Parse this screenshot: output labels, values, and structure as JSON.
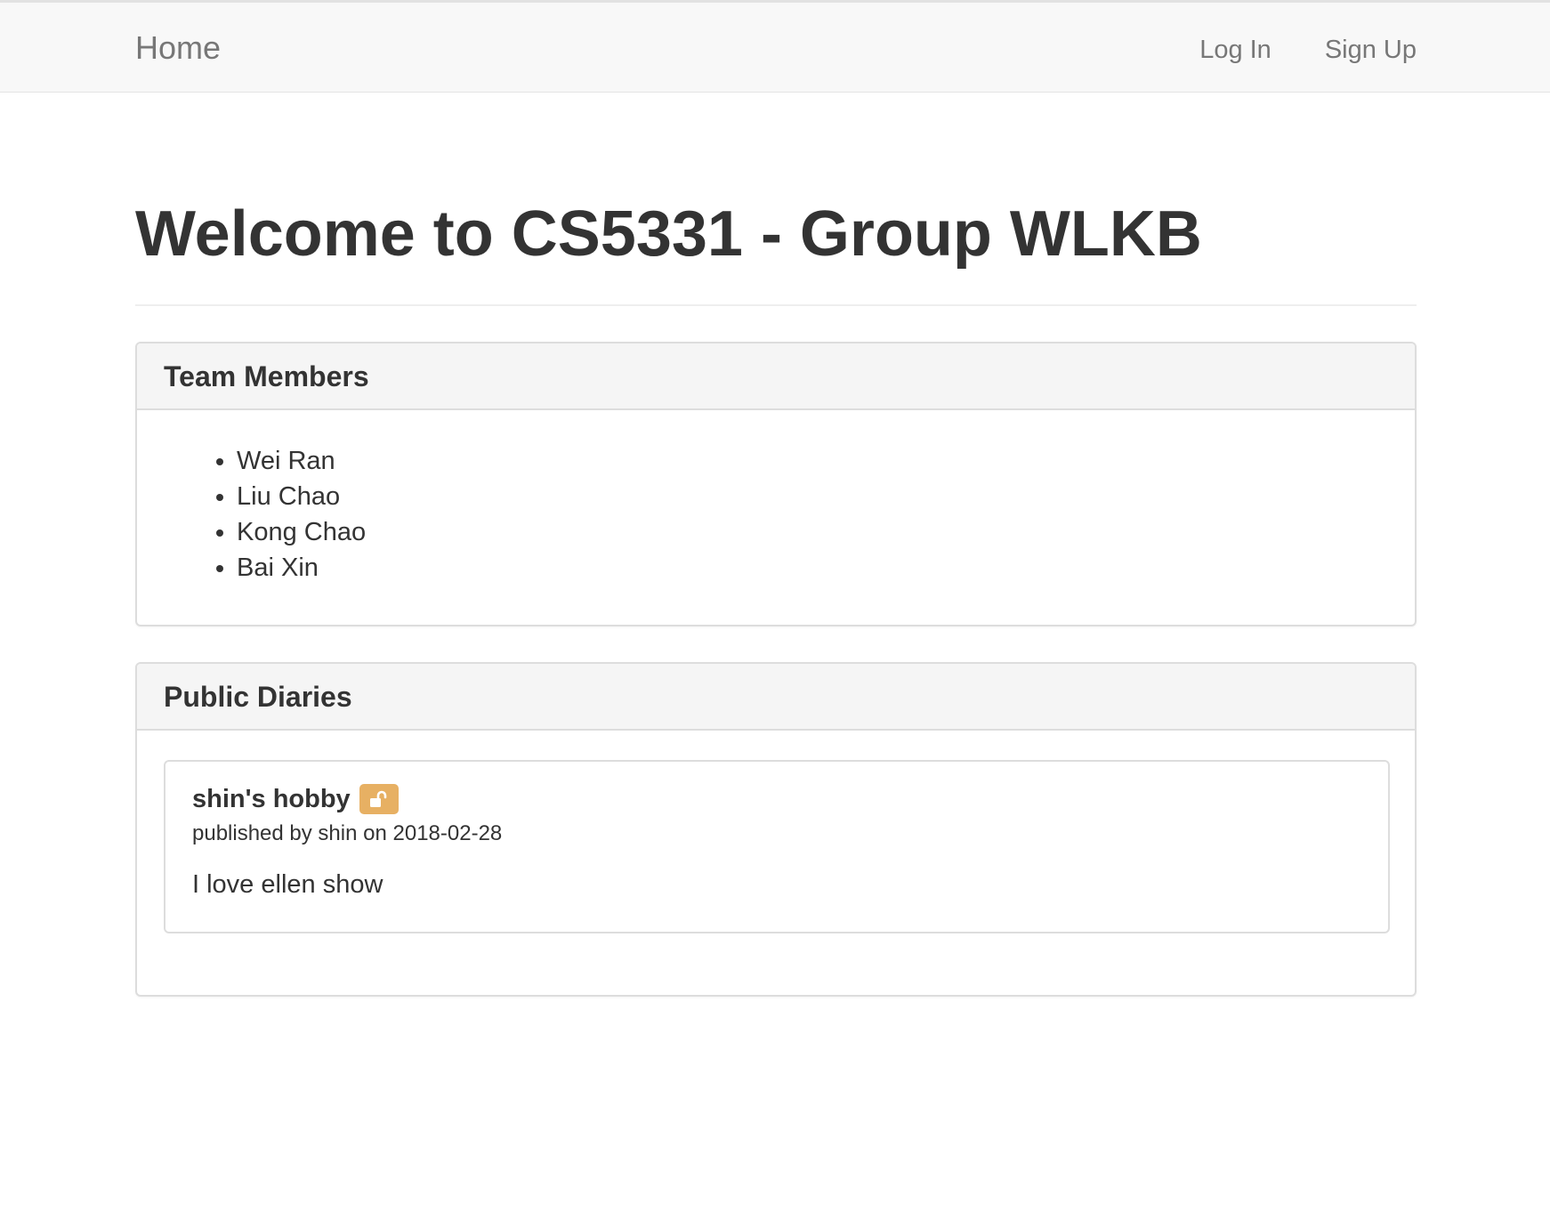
{
  "navbar": {
    "brand": "Home",
    "login": "Log In",
    "signup": "Sign Up"
  },
  "page": {
    "title": "Welcome to CS5331 - Group WLKB"
  },
  "team": {
    "heading": "Team Members",
    "members": [
      "Wei Ran",
      "Liu Chao",
      "Kong Chao",
      "Bai Xin"
    ]
  },
  "diaries": {
    "heading": "Public Diaries",
    "items": [
      {
        "title": "shin's hobby",
        "icon": "unlock-icon",
        "meta": "published by shin on 2018-02-28",
        "body": "I love ellen show"
      }
    ]
  },
  "colors": {
    "badge": "#e7b063",
    "navbar_bg": "#f8f8f8",
    "panel_heading_bg": "#f5f5f5"
  }
}
